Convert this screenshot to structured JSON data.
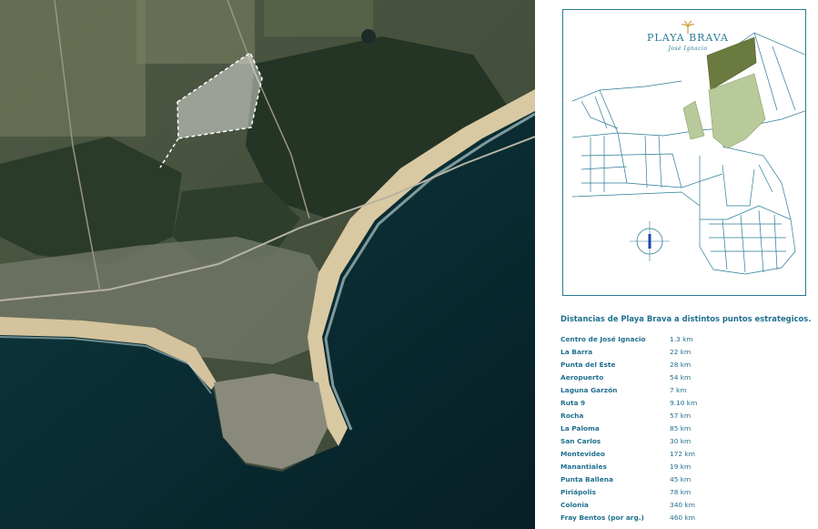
{
  "logo": {
    "title": "PLAYA BRAVA",
    "subtitle": "José Ignacio",
    "icon": "palm-tree-icon"
  },
  "map": {
    "compass_icon": "compass-icon",
    "colors": {
      "line": "#2a7b97",
      "parcel_dark": "#6b7a3e",
      "parcel_light": "#b8c99a"
    }
  },
  "distances": {
    "title": "Distancias de Playa Brava a distintos puntos estrategicos.",
    "items": [
      {
        "place": "Centro de José Ignacio",
        "km": "1.3 km"
      },
      {
        "place": "La Barra",
        "km": "22 km"
      },
      {
        "place": "Punta del Este",
        "km": "28 km"
      },
      {
        "place": "Aeropuerto",
        "km": "54 km"
      },
      {
        "place": "Laguna Garzón",
        "km": "7 km"
      },
      {
        "place": "Ruta 9",
        "km": "9.10 km"
      },
      {
        "place": "Rocha",
        "km": "57 km"
      },
      {
        "place": "La Paloma",
        "km": "85 km"
      },
      {
        "place": "San Carlos",
        "km": "30 km"
      },
      {
        "place": "Montevideo",
        "km": "172 km"
      },
      {
        "place": "Manantiales",
        "km": "19 km"
      },
      {
        "place": "Punta Ballena",
        "km": "45 km"
      },
      {
        "place": "Piriápolis",
        "km": "78 km"
      },
      {
        "place": "Colonia",
        "km": "340 km"
      },
      {
        "place": "Fray Bentos (por arg.)",
        "km": "460 km"
      }
    ]
  }
}
